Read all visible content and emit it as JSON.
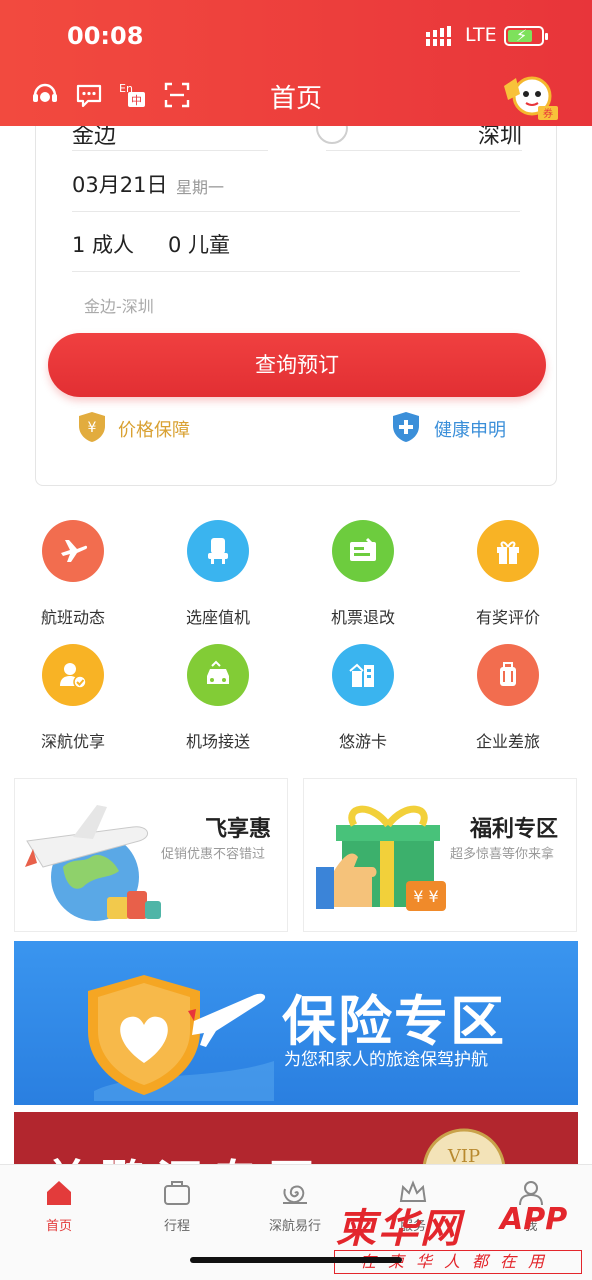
{
  "status_bar": {
    "time": "00:08",
    "network": "LTE"
  },
  "header": {
    "title": "首页"
  },
  "booking": {
    "from_city": "金边",
    "to_city": "深圳",
    "date": "03月21日",
    "weekday": "星期一",
    "adults": "1 成人",
    "children": "0 儿童",
    "history": "金边-深圳",
    "search_label": "查询预订",
    "price_guarantee": "价格保障",
    "health_declaration": "健康申明"
  },
  "services": [
    {
      "label": "航班动态",
      "color": "#f26d4f",
      "icon": "plane-icon"
    },
    {
      "label": "选座值机",
      "color": "#3ab4ef",
      "icon": "seat-icon"
    },
    {
      "label": "机票退改",
      "color": "#6dcc3e",
      "icon": "ticket-icon"
    },
    {
      "label": "有奖评价",
      "color": "#f8b325",
      "icon": "gift-icon"
    },
    {
      "label": "深航优享",
      "color": "#f8b325",
      "icon": "user-check-icon"
    },
    {
      "label": "机场接送",
      "color": "#82cc36",
      "icon": "car-icon"
    },
    {
      "label": "悠游卡",
      "color": "#3ab4ef",
      "icon": "building-icon"
    },
    {
      "label": "企业差旅",
      "color": "#f26d4f",
      "icon": "luggage-icon"
    }
  ],
  "promos": [
    {
      "title": "飞享惠",
      "subtitle": "促销优惠不容错过"
    },
    {
      "title": "福利专区",
      "subtitle": "超多惊喜等你来拿"
    }
  ],
  "insurance": {
    "title": "保险专区",
    "subtitle": "为您和家人的旅途保驾护航"
  },
  "red_banner": {
    "text": "美鹏汇专区",
    "badge": "VIP"
  },
  "tabs": [
    {
      "label": "首页",
      "active": true
    },
    {
      "label": "行程",
      "active": false
    },
    {
      "label": "深航易行",
      "active": false
    },
    {
      "label": "服务",
      "active": false
    },
    {
      "label": "我",
      "active": false
    }
  ],
  "watermark": {
    "brand": "柬华网",
    "app": "APP",
    "slogan": "在柬华人都在用"
  },
  "colors": {
    "brand_red": "#e8353a",
    "gold": "#d9a132",
    "blue": "#3b8fd9"
  }
}
